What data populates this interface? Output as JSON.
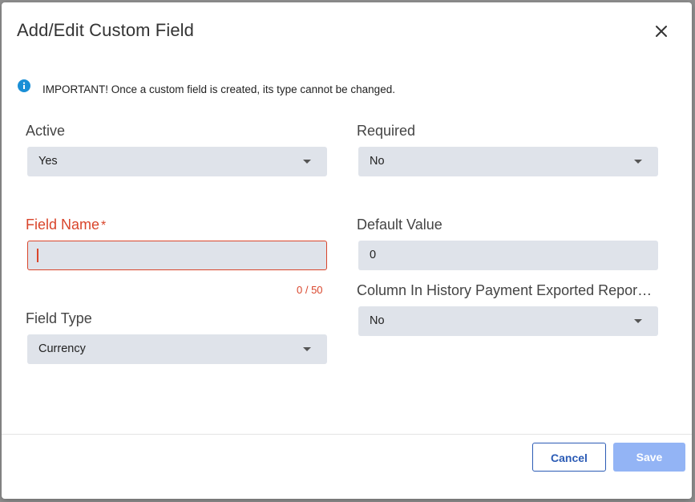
{
  "dialog": {
    "title": "Add/Edit Custom Field",
    "close_icon": "close-icon"
  },
  "notice": {
    "icon": "info-icon",
    "text": "IMPORTANT! Once a custom field is created, its type cannot be changed."
  },
  "fields": {
    "active": {
      "label": "Active",
      "value": "Yes"
    },
    "required": {
      "label": "Required",
      "value": "No"
    },
    "field_name": {
      "label": "Field Name",
      "required_mark": "*",
      "value": "",
      "counter": "0 / 50"
    },
    "default_value": {
      "label": "Default Value",
      "value": "0"
    },
    "column_history": {
      "label": "Column In History Payment Exported Repor…",
      "value": "No"
    },
    "field_type": {
      "label": "Field Type",
      "value": "Currency"
    }
  },
  "footer": {
    "cancel_label": "Cancel",
    "save_label": "Save"
  },
  "colors": {
    "accent": "#2b5bb5",
    "error": "#d9452b",
    "save_disabled": "#93b4f5",
    "field_bg": "#dfe3ea",
    "info": "#1a8fd6"
  }
}
